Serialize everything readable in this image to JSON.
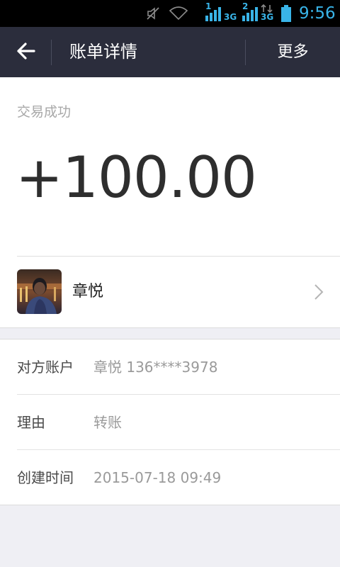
{
  "status_bar": {
    "sim1_label": "1",
    "sim2_label": "2",
    "sim1_network": "3G",
    "sim2_network": "3G",
    "time": "9:56",
    "icons": [
      "mute-icon",
      "wifi-icon",
      "signal-icon",
      "signal-icon",
      "data-arrows-icon",
      "battery-icon"
    ]
  },
  "header": {
    "back_icon": "back-arrow-icon",
    "title": "账单详情",
    "more_label": "更多"
  },
  "transaction": {
    "status": "交易成功",
    "amount": "+100.00"
  },
  "contact": {
    "name": "章悦",
    "chevron_icon": "chevron-right-icon"
  },
  "details": [
    {
      "label": "对方账户",
      "value": "章悦 136****3978"
    },
    {
      "label": "理由",
      "value": "转账"
    },
    {
      "label": "创建时间",
      "value": "2015-07-18 09:49"
    }
  ],
  "colors": {
    "header_bg": "#2b2d3c",
    "status_accent": "#39b4e8",
    "page_bg": "#efeff4"
  }
}
